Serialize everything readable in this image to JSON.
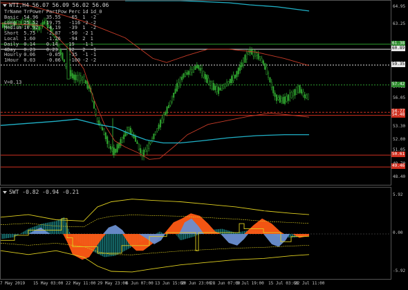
{
  "main": {
    "title": "WTI,H4  56.07 56.09 56.02 56.06",
    "info_headers": [
      "TrName",
      "TrPower",
      "PartPow",
      "Perc",
      "1d",
      "1d_0"
    ],
    "info_rows": [
      [
        "Basic",
        "54.96",
        "35.55",
        "-65",
        "1",
        "-2"
      ],
      [
        "Long",
        "25.52",
        "19.75",
        "-116",
        "-2",
        "-2"
      ],
      [
        "Medium",
        "10.92",
        "-4.19",
        "-39",
        "1",
        "-2"
      ],
      [
        "Short",
        "5.75",
        "-2.87",
        "-50",
        "-2",
        "1"
      ],
      [
        "Local",
        "1.60",
        "-1.26",
        "-94",
        "2",
        "1"
      ],
      [
        "Daily",
        "0.14",
        "0.14",
        "19",
        "-1",
        "1"
      ],
      [
        "4Day",
        "0.23",
        "0.23",
        "92",
        "2",
        "-1"
      ],
      [
        "Hourly",
        "0.06",
        "-0.05",
        "-35",
        "-1",
        "-1"
      ],
      [
        "1Hour",
        "0.03",
        "-0.06",
        "-100",
        "-2",
        "-2"
      ]
    ],
    "v_label": "V=0.13",
    "y_ticks": [
      {
        "label": "64.95",
        "v": 64.95
      },
      {
        "label": "63.25",
        "v": 63.25
      },
      {
        "label": "59.35",
        "v": 59.35
      },
      {
        "label": "57.15",
        "v": 57.15
      },
      {
        "label": "56.05",
        "v": 56.05
      },
      {
        "label": "53.30",
        "v": 53.3
      },
      {
        "label": "52.00",
        "v": 52.0
      },
      {
        "label": "51.05",
        "v": 51.05
      },
      {
        "label": "49.70",
        "v": 49.7
      },
      {
        "label": "48.40",
        "v": 48.4
      }
    ],
    "price_tags": [
      {
        "label": "61.38",
        "v": 61.38,
        "bg": "#2e8b2e",
        "fg": "#ffffff"
      },
      {
        "label": "60.89",
        "v": 60.89,
        "bg": "#e8e8e8",
        "fg": "#000000"
      },
      {
        "label": "59.35",
        "v": 59.35,
        "bg": "#e8e8e8",
        "fg": "#000000"
      },
      {
        "label": "57.42",
        "v": 57.42,
        "bg": "#2e8b2e",
        "fg": "#ffffff"
      },
      {
        "label": "54.77",
        "v": 54.77,
        "bg": "#d03020",
        "fg": "#ffffff"
      },
      {
        "label": "54.48",
        "v": 54.48,
        "bg": "#d03020",
        "fg": "#ffffff"
      },
      {
        "label": "50.61",
        "v": 50.61,
        "bg": "#d03020",
        "fg": "#ffffff"
      },
      {
        "label": "49.46",
        "v": 49.46,
        "bg": "#d03020",
        "fg": "#ffffff"
      }
    ]
  },
  "indicator": {
    "title": "SWT -0.82 -0.94 -0.21",
    "y_ticks": [
      {
        "label": "5.92",
        "v": 5.92
      },
      {
        "label": "0.00",
        "v": 0
      },
      {
        "label": "-5.92",
        "v": -5.92
      }
    ]
  },
  "x_ticks": [
    "7 May 2019",
    "15 May 03:00",
    "22 May 11:00",
    "29 May 23:00",
    "6 Jun 07:00",
    "13 Jun 15:00",
    "20 Jun 23:00",
    "28 Jun 07:00",
    "5 Jul 19:00",
    "15 Jul 03:00",
    "22 Jul 11:00"
  ],
  "colors": {
    "bull_candle": "#2ea02e",
    "wick": "#2ea02e",
    "ma_red": "#c83c28",
    "ma_cyan": "#20b2c8",
    "level_green": "#2ea02e",
    "level_white": "#e0e0e0",
    "level_red": "#d03020",
    "ind_orange": "#ff5a14",
    "ind_blue": "#6a8fd0",
    "ind_teal": "#20a0a0",
    "ind_yellow": "#e0d020"
  }
}
